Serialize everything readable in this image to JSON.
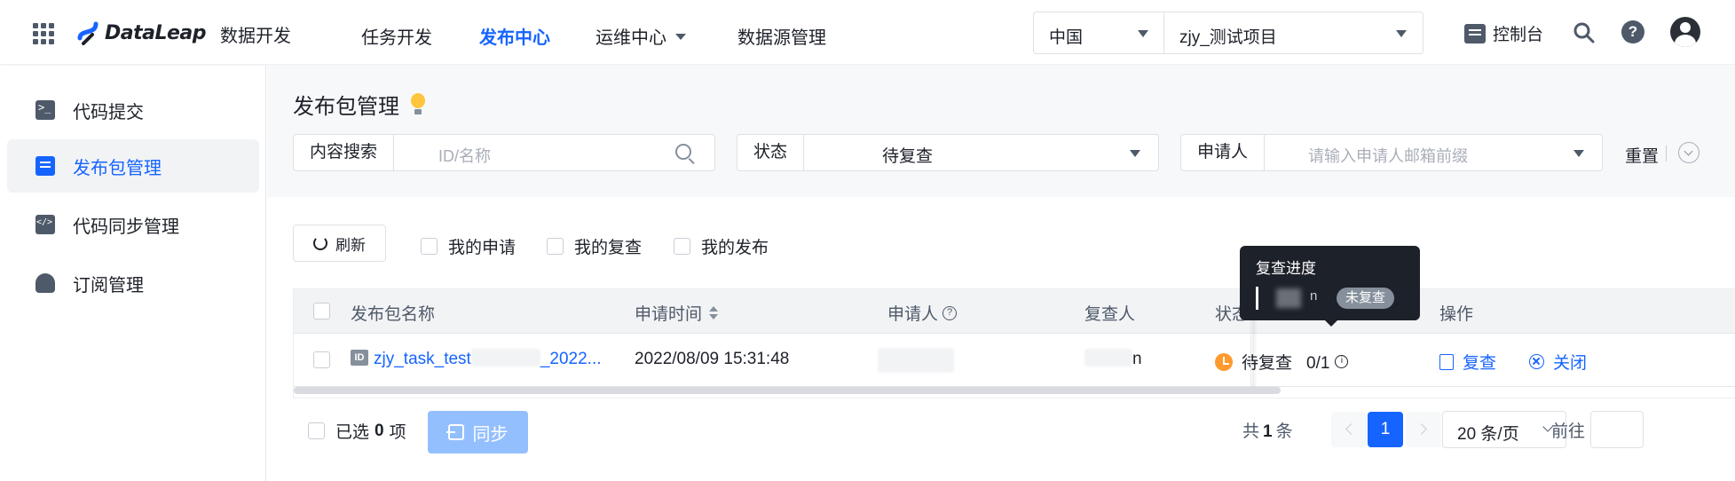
{
  "header": {
    "product_name": "数据开发",
    "logo_text": "DataLeap",
    "nav": [
      {
        "label": "任务开发",
        "active": false
      },
      {
        "label": "发布中心",
        "active": true
      },
      {
        "label": "运维中心",
        "active": false,
        "has_dropdown": true
      },
      {
        "label": "数据源管理",
        "active": false
      }
    ],
    "region": "中国",
    "project": "zjy_测试项目",
    "console_label": "控制台",
    "icons": [
      "apps-grid-icon",
      "search-icon",
      "help-icon",
      "user-avatar-icon"
    ]
  },
  "sidebar": {
    "items": [
      {
        "label": "代码提交",
        "icon": "terminal-icon",
        "active": false
      },
      {
        "label": "发布包管理",
        "icon": "package-icon",
        "active": true
      },
      {
        "label": "代码同步管理",
        "icon": "code-sync-icon",
        "active": false
      },
      {
        "label": "订阅管理",
        "icon": "bell-icon",
        "active": false
      }
    ]
  },
  "page": {
    "title": "发布包管理",
    "filters": {
      "content_search": {
        "label": "内容搜索",
        "placeholder": "ID/名称"
      },
      "status": {
        "label": "状态",
        "value": "待复查"
      },
      "applicant": {
        "label": "申请人",
        "placeholder": "请输入申请人邮箱前缀"
      },
      "reset_label": "重置"
    },
    "toolbar": {
      "refresh_label": "刷新",
      "my_apply": "我的申请",
      "my_review": "我的复查",
      "my_publish": "我的发布"
    },
    "table": {
      "columns": [
        "发布包名称",
        "申请时间",
        "申请人",
        "复查人",
        "状态",
        "操作"
      ],
      "rows": [
        {
          "id_badge": "ID",
          "name_prefix": "zjy_task_test",
          "name_suffix": "_2022...",
          "apply_time": "2022/08/09  15:31:48",
          "reviewer_tail": "n",
          "status": "待复查",
          "progress": "0/1",
          "actions": [
            "复查",
            "关闭"
          ]
        }
      ]
    },
    "tooltip": {
      "title": "复查进度",
      "user_tail": "n",
      "tag": "未复查"
    },
    "footer": {
      "selected_prefix": "已选",
      "selected_count": "0",
      "selected_suffix": "项",
      "sync_label": "同步",
      "total_prefix": "共",
      "total_count": "1",
      "total_suffix": "条",
      "current_page": "1",
      "page_size": "20 条/页",
      "goto_label": "前往"
    }
  },
  "colors": {
    "accent": "#1664ff",
    "status_pending": "#ff9a2e",
    "sync_disabled": "#94bfff",
    "tooltip_bg": "#1d2129"
  }
}
